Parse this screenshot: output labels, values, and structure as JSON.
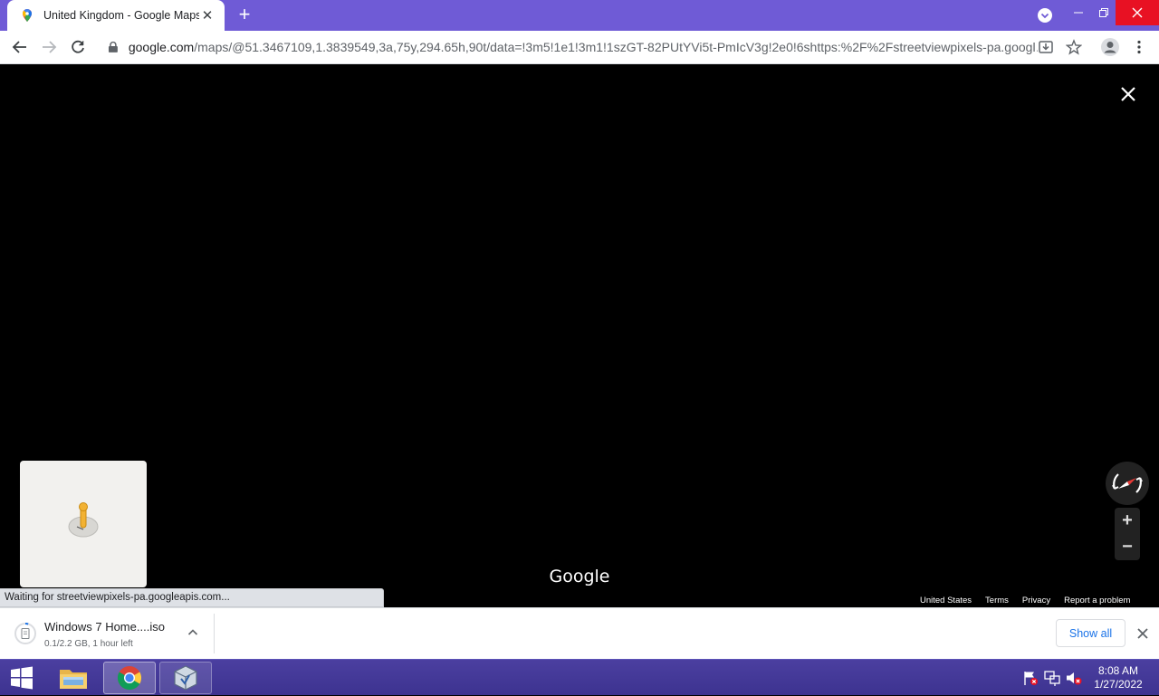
{
  "browser": {
    "tab_title": "United Kingdom - Google Maps",
    "new_tab_symbol": "+",
    "url_domain": "google.com",
    "url_path": "/maps/@51.3467109,1.3839549,3a,75y,294.65h,90t/data=!3m5!1e1!3m1!1szGT-82PUtYVi5t-PmIcV3g!2e0!6shttps:%2F%2Fstreetviewpixels-pa.googl…",
    "status_text": "Waiting for streetviewpixels-pa.googleapis.com..."
  },
  "map": {
    "logo_text": "Google",
    "footer_links": [
      "United States",
      "Terms",
      "Privacy",
      "Report a problem"
    ],
    "zoom_in": "+",
    "zoom_out": "−"
  },
  "download": {
    "file_name": "Windows 7 Home....iso",
    "status": "0.1/2.2 GB, 1 hour left",
    "show_all_label": "Show all"
  },
  "taskbar": {
    "time": "8:08 AM",
    "date": "1/27/2022",
    "apps": [
      "file-explorer-icon",
      "chrome-icon",
      "virtualbox-icon"
    ]
  },
  "colors": {
    "titlebar": "#6f5bd6",
    "taskbar": "#4b3fa0",
    "close_red": "#e81123",
    "link_blue": "#1a73e8"
  }
}
